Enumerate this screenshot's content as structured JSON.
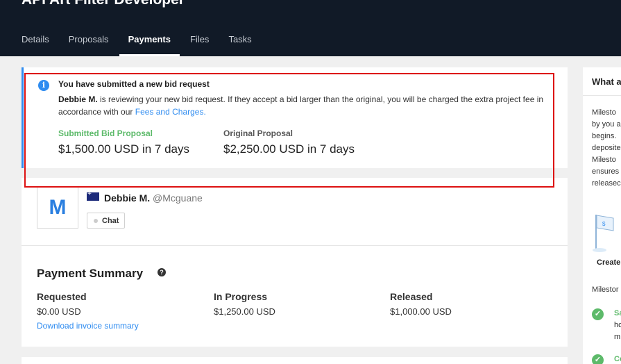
{
  "header": {
    "title": "API Art Filter Developer",
    "tabs": [
      {
        "label": "Details"
      },
      {
        "label": "Proposals"
      },
      {
        "label": "Payments",
        "active": true
      },
      {
        "label": "Files"
      },
      {
        "label": "Tasks"
      }
    ]
  },
  "alert": {
    "title": "You have submitted a new bid request",
    "user": "Debbie M.",
    "message": "is reviewing your new bid request. If they accept a bid larger than the original, you will be charged the extra project fee in accordance with our",
    "link": "Fees and Charges.",
    "submitted_label": "Submitted Bid Proposal",
    "submitted_amount": "$1,500.00 USD in 7 days",
    "original_label": "Original Proposal",
    "original_amount": "$2,250.00 USD in 7 days"
  },
  "user": {
    "avatar_letter": "M",
    "name": "Debbie M.",
    "handle": "@Mcguane",
    "chat_label": "Chat"
  },
  "summary": {
    "title": "Payment Summary",
    "requested_label": "Requested",
    "requested_value": "$0.00 USD",
    "in_progress_label": "In Progress",
    "in_progress_value": "$1,250.00 USD",
    "released_label": "Released",
    "released_value": "$1,000.00 USD",
    "download_link": "Download invoice summary"
  },
  "side": {
    "title": "What a",
    "lines": [
      "Milesto",
      "by you a",
      "begins.",
      "deposite",
      "Milesto",
      "ensures",
      "releasec"
    ],
    "create_label": "Create",
    "milestone_label": "Milestor",
    "item1_a": "Sa",
    "item1_b": "hc",
    "item1_c": "m",
    "item2_a": "Cc"
  },
  "colors": {
    "header_bg": "#111a27",
    "accent": "#2f8cf0",
    "success": "#5dba6a",
    "highlight_border": "#dd1111"
  }
}
